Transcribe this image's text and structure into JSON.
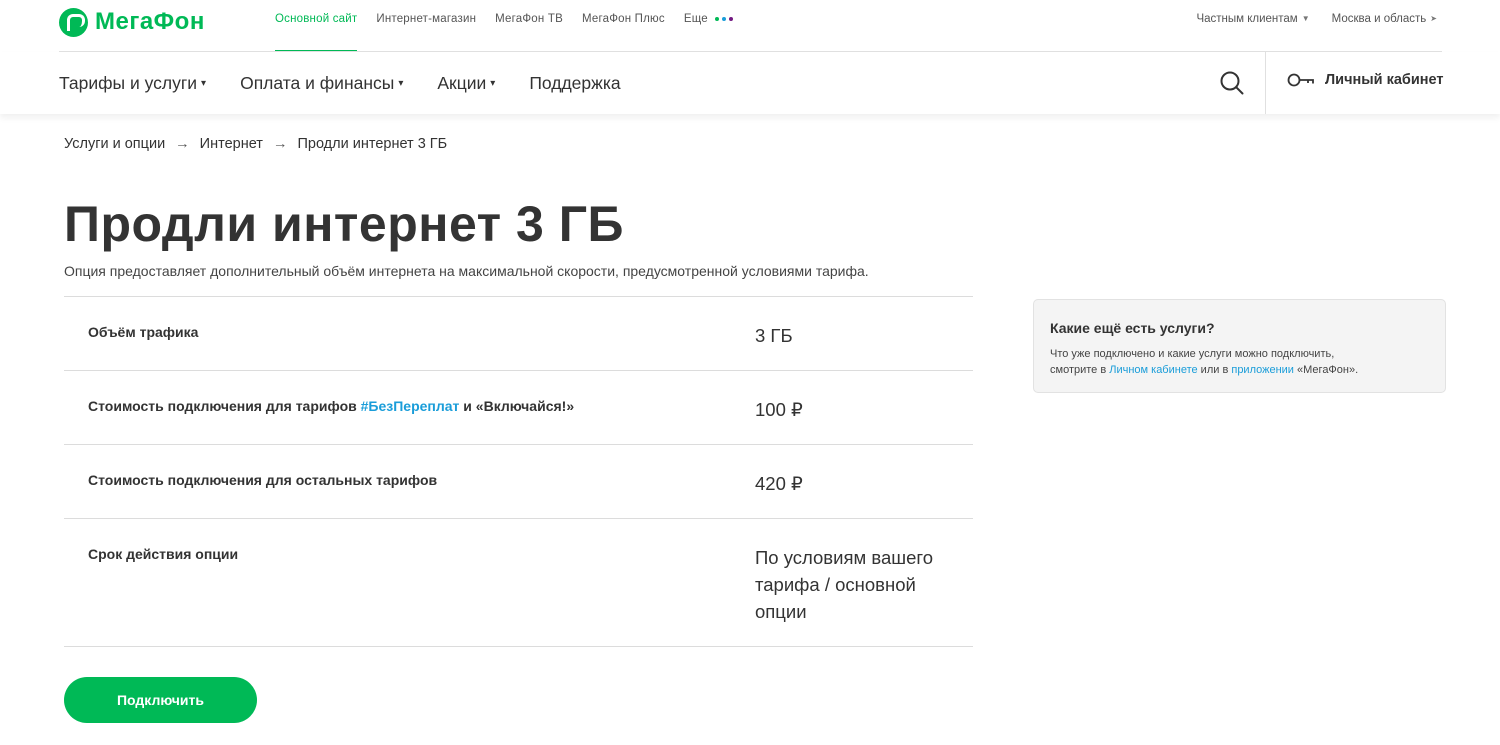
{
  "header": {
    "logo_text": "МегаФон",
    "site_nav": [
      {
        "label": "Основной сайт",
        "active": true
      },
      {
        "label": "Интернет-магазин",
        "active": false
      },
      {
        "label": "МегаФон ТВ",
        "active": false
      },
      {
        "label": "МегаФон Плюс",
        "active": false
      },
      {
        "label": "Еще",
        "active": false
      }
    ],
    "more_dot_colors": [
      "#00b956",
      "#1a9dd9",
      "#731982"
    ],
    "client_type": "Частным клиентам",
    "region": "Москва и область"
  },
  "main_nav": {
    "items": [
      {
        "label": "Тарифы и услуги",
        "has_dropdown": true
      },
      {
        "label": "Оплата и финансы",
        "has_dropdown": true
      },
      {
        "label": "Акции",
        "has_dropdown": true
      },
      {
        "label": "Поддержка",
        "has_dropdown": false
      }
    ],
    "search_icon": "search-icon",
    "cabinet_icon": "key-icon",
    "cabinet_label": "Личный кабинет"
  },
  "breadcrumb": {
    "items": [
      "Услуги и опции",
      "Интернет",
      "Продли интернет 3 ГБ"
    ],
    "separator": "→"
  },
  "page": {
    "title": "Продли интернет 3 ГБ",
    "subtitle": "Опция предоставляет дополнительный объём интернета на максимальной скорости, предусмотренной условиями тарифа."
  },
  "params": {
    "rows": [
      {
        "label": "Объём трафика",
        "value": "3 ГБ"
      },
      {
        "label_before": "Стоимость подключения для тарифов ",
        "label_link": "#БезПереплат",
        "label_after": " и «Включайся!»",
        "value": "100 ₽"
      },
      {
        "label": "Стоимость подключения для остальных тарифов",
        "value": "420 ₽"
      },
      {
        "label": "Срок действия опции",
        "value": "По условиям вашего тарифа / основной опции"
      }
    ]
  },
  "connect_button": {
    "label": "Подключить"
  },
  "side_card": {
    "title": "Какие ещё есть услуги?",
    "text_1": "Что уже подключено и какие услуги можно подключить,",
    "text_2": "смотрите в ",
    "link_1": "Личном кабинете",
    "text_3": " или в ",
    "link_2": "приложении",
    "text_4": " «МегаФон»."
  },
  "colors": {
    "brand_green": "#00b956",
    "link_blue": "#1a9dd9",
    "text": "#333333"
  }
}
